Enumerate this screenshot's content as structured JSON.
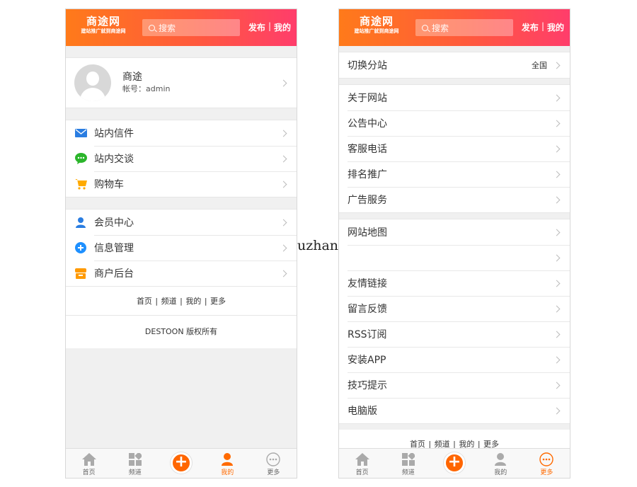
{
  "header": {
    "logo_title": "商途网",
    "logo_slogan": "建站推广就到商途网",
    "search_placeholder": "搜索",
    "link_publish": "发布",
    "link_separator": "|",
    "link_mine": "我的"
  },
  "left": {
    "profile": {
      "name": "商途",
      "account": "帐号：admin"
    },
    "group1": [
      {
        "label": "站内信件",
        "icon": "mail-icon"
      },
      {
        "label": "站内交谈",
        "icon": "chat-icon"
      },
      {
        "label": "购物车",
        "icon": "cart-icon"
      }
    ],
    "group2": [
      {
        "label": "会员中心",
        "icon": "user-icon"
      },
      {
        "label": "信息管理",
        "icon": "plus-circle-icon"
      },
      {
        "label": "商户后台",
        "icon": "store-icon"
      }
    ],
    "footer_links": [
      "首页",
      "频道",
      "我的",
      "更多"
    ],
    "copyright": "DESTOON 版权所有",
    "tabbar": {
      "items": [
        "首页",
        "频道",
        "",
        "我的",
        "更多"
      ],
      "active": "我的"
    }
  },
  "right": {
    "switch_site": {
      "label": "切换分站",
      "value": "全国"
    },
    "group1": [
      "关于网站",
      "公告中心",
      "客服电话",
      "排名推广",
      "广告服务"
    ],
    "group2": [
      "网站地图",
      "",
      "友情链接",
      "留言反馈",
      "RSS订阅",
      "安装APP",
      "技巧提示",
      "电脑版"
    ],
    "footer_links": [
      "首页",
      "频道",
      "我的",
      "更多"
    ],
    "tabbar": {
      "items": [
        "首页",
        "频道",
        "",
        "我的",
        "更多"
      ],
      "active": "更多"
    }
  },
  "watermark_text": "uzhan",
  "colors": {
    "header_gradient_start": "#ff7a1a",
    "header_gradient_end": "#ff3d6b",
    "accent": "#ff6600",
    "mail_blue": "#2a7de1",
    "chat_green": "#2bb52b",
    "cart_orange": "#ffaa00"
  }
}
